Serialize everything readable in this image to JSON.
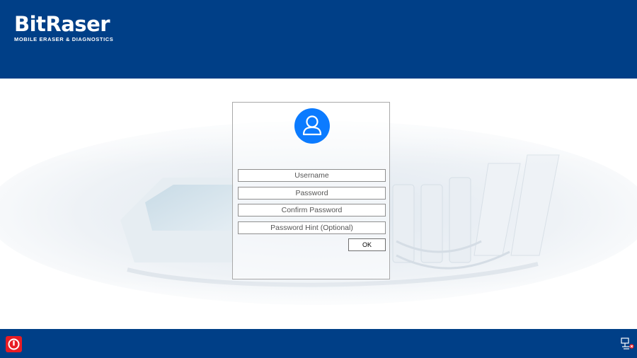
{
  "brand": {
    "name": "BitRaser",
    "tagline": "MOBILE ERASER & DIAGNOSTICS"
  },
  "form": {
    "avatar_icon": "user-icon",
    "username_placeholder": "Username",
    "password_placeholder": "Password",
    "confirm_password_placeholder": "Confirm Password",
    "password_hint_placeholder": "Password Hint (Optional)",
    "ok_label": "OK"
  },
  "footer": {
    "power_icon": "power-icon",
    "network_icon": "network-disconnected-icon"
  },
  "colors": {
    "header_bg": "#003f87",
    "avatar_bg": "#0b7bff",
    "power_bg": "#e81c24"
  }
}
